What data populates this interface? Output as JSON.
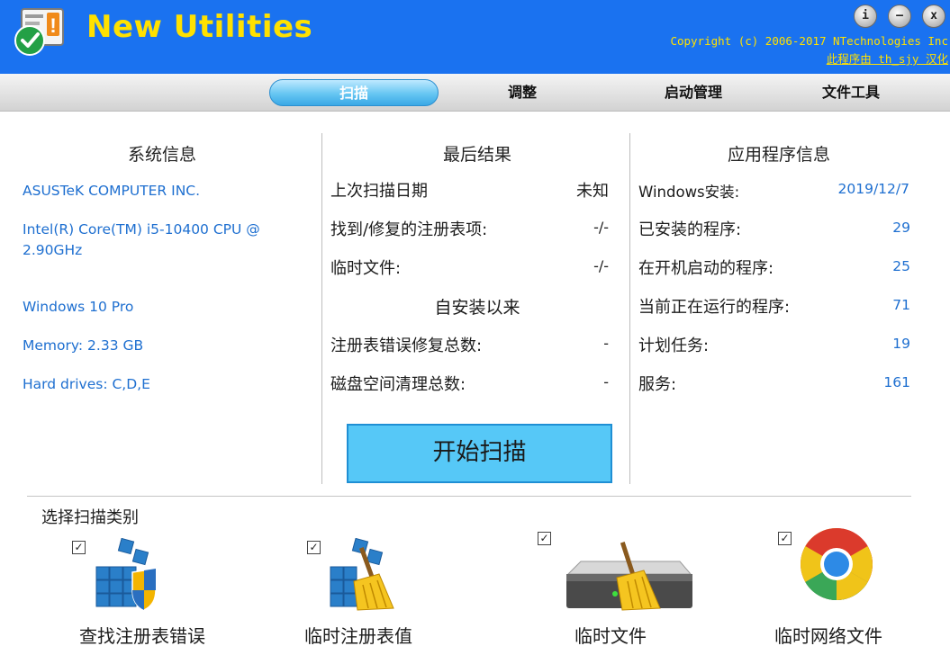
{
  "header": {
    "app_title": "New Utilities",
    "copyright": "Copyright (c) 2006-2017 NTechnologies Inc",
    "credit": "此程序由 th_sjy 汉化",
    "buttons": {
      "info": "i",
      "minimize": "–",
      "close": "x"
    }
  },
  "tabs": [
    {
      "label": "扫描",
      "active": true
    },
    {
      "label": "调整",
      "active": false
    },
    {
      "label": "启动管理",
      "active": false
    },
    {
      "label": "文件工具",
      "active": false
    }
  ],
  "system_info": {
    "title": "系统信息",
    "manufacturer": "ASUSTeK COMPUTER INC.",
    "cpu": "Intel(R) Core(TM) i5-10400 CPU @ 2.90GHz",
    "os": "Windows 10 Pro",
    "memory": "Memory: 2.33 GB",
    "drives": "Hard drives: C,D,E"
  },
  "last_result": {
    "title": "最后结果",
    "rows": [
      {
        "label": "上次扫描日期",
        "value": "未知"
      },
      {
        "label": "找到/修复的注册表项:",
        "value": "-/-"
      },
      {
        "label": "临时文件:",
        "value": "-/-"
      }
    ],
    "since_install_title": "自安装以来",
    "since_rows": [
      {
        "label": "注册表错误修复总数:",
        "value": "-"
      },
      {
        "label": "磁盘空间清理总数:",
        "value": "-"
      }
    ],
    "scan_button": "开始扫描"
  },
  "app_info": {
    "title": "应用程序信息",
    "rows": [
      {
        "label": "Windows安装:",
        "value": "2019/12/7"
      },
      {
        "label": "已安装的程序:",
        "value": "29"
      },
      {
        "label": "在开机启动的程序:",
        "value": "25"
      },
      {
        "label": "当前正在运行的程序:",
        "value": "71"
      },
      {
        "label": "计划任务:",
        "value": "19"
      },
      {
        "label": "服务:",
        "value": "161"
      }
    ]
  },
  "scan_categories": {
    "title": "选择扫描类别",
    "items": [
      {
        "label": "查找注册表错误",
        "checked": true,
        "icon": "registry-shield-icon"
      },
      {
        "label": "临时注册表值",
        "checked": true,
        "icon": "registry-broom-icon"
      },
      {
        "label": "临时文件",
        "checked": true,
        "icon": "drive-broom-icon"
      },
      {
        "label": "临时网络文件",
        "checked": true,
        "icon": "chrome-icon"
      }
    ]
  },
  "colors": {
    "header_bg": "#1a72f0",
    "title_yellow": "#ffe100",
    "link_blue": "#1e6fd0",
    "scan_button": "#56c8f7"
  }
}
